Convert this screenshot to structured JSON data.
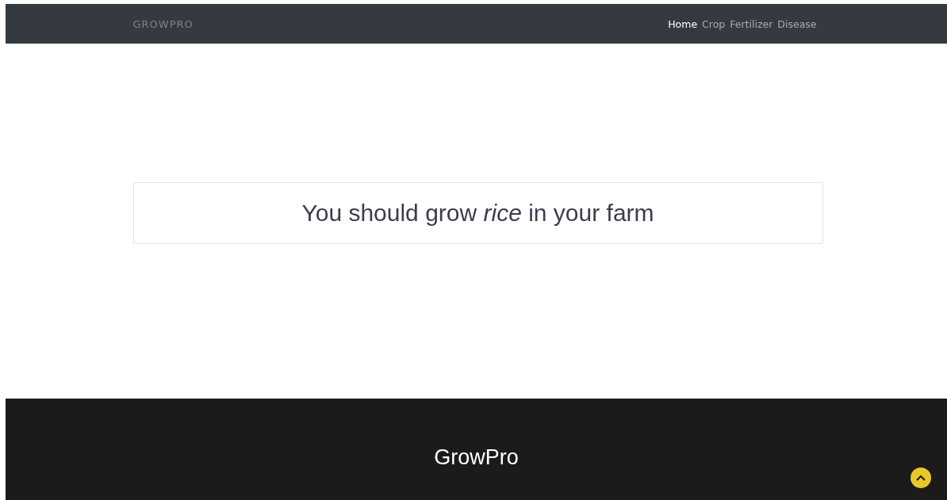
{
  "navbar": {
    "brand": "GROWPRO",
    "links": [
      {
        "label": "Home",
        "selected": true
      },
      {
        "label": "Crop",
        "selected": false
      },
      {
        "label": "Fertilizer",
        "selected": false
      },
      {
        "label": "Disease",
        "selected": false
      }
    ]
  },
  "result": {
    "message": "You should grow *rice* in your farm"
  },
  "footer": {
    "title": "GrowPro"
  }
}
